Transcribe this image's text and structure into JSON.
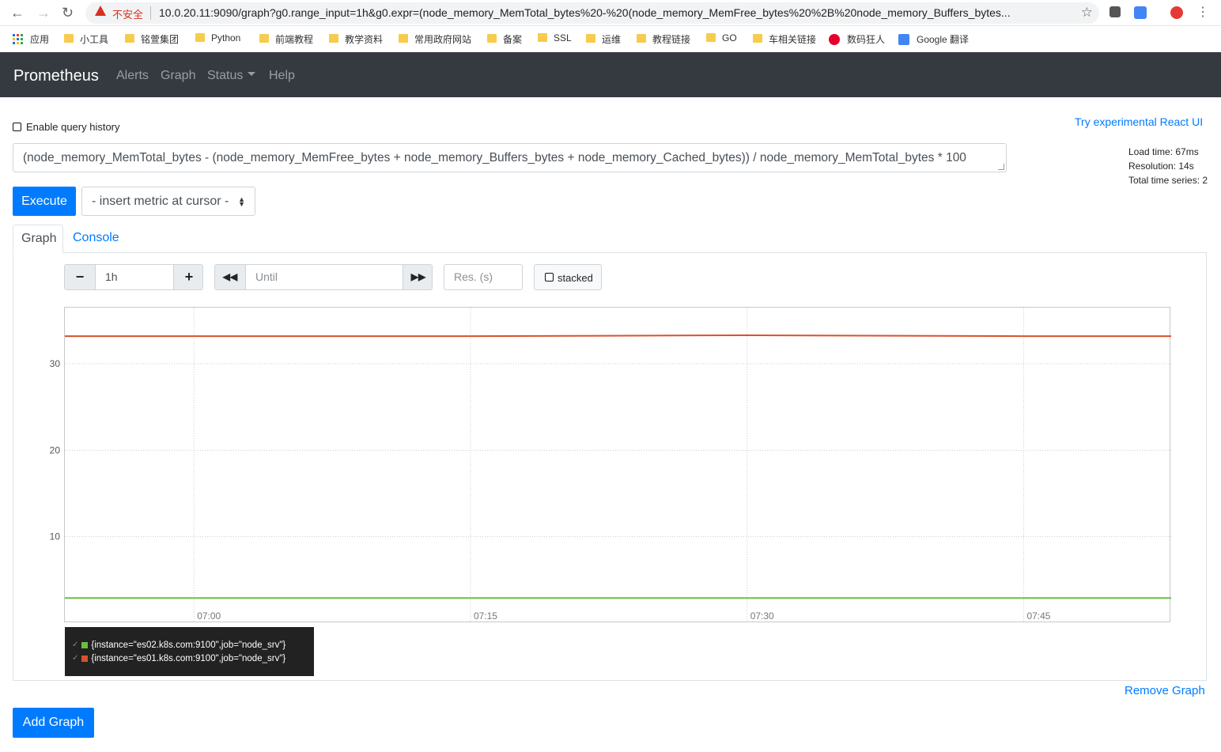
{
  "browser": {
    "not_secure": "不安全",
    "url": "10.0.20.11:9090/graph?g0.range_input=1h&g0.expr=(node_memory_MemTotal_bytes%20-%20(node_memory_MemFree_bytes%20%2B%20node_memory_Buffers_bytes...",
    "bookmarks": [
      {
        "label": "应用",
        "icon": "apps-icon"
      },
      {
        "label": "小工具",
        "icon": "folder-icon"
      },
      {
        "label": "铭萱集团",
        "icon": "folder-icon"
      },
      {
        "label": "Python",
        "icon": "folder-icon"
      },
      {
        "label": "前端教程",
        "icon": "folder-icon"
      },
      {
        "label": "教学资料",
        "icon": "folder-icon"
      },
      {
        "label": "常用政府网站",
        "icon": "folder-icon"
      },
      {
        "label": "备案",
        "icon": "folder-icon"
      },
      {
        "label": "SSL",
        "icon": "folder-icon"
      },
      {
        "label": "运维",
        "icon": "folder-icon"
      },
      {
        "label": "教程链接",
        "icon": "folder-icon"
      },
      {
        "label": "GO",
        "icon": "folder-icon"
      },
      {
        "label": "车相关链接",
        "icon": "folder-icon"
      },
      {
        "label": "数码狂人",
        "icon": "site-icon"
      },
      {
        "label": "Google 翻译",
        "icon": "translate-icon"
      }
    ]
  },
  "navbar": {
    "brand": "Prometheus",
    "links": [
      "Alerts",
      "Graph",
      "Status",
      "Help"
    ]
  },
  "page": {
    "enable_history": "Enable query history",
    "react_ui_link": "Try experimental React UI",
    "expression": "(node_memory_MemTotal_bytes - (node_memory_MemFree_bytes + node_memory_Buffers_bytes + node_memory_Cached_bytes)) / node_memory_MemTotal_bytes * 100",
    "stats": {
      "load_time": "Load time: 67ms",
      "resolution": "Resolution: 14s",
      "total_series": "Total time series: 2"
    },
    "execute": "Execute",
    "insert_metric": "- insert metric at cursor -",
    "tabs": [
      "Graph",
      "Console"
    ],
    "range_value": "1h",
    "until_placeholder": "Until",
    "res_placeholder": "Res. (s)",
    "stacked": "stacked",
    "remove_graph": "Remove Graph",
    "add_graph": "Add Graph"
  },
  "colors": {
    "accent": "#007bff",
    "navbar": "#343a40",
    "series_green": "#6abf40",
    "series_red": "#d9512c"
  },
  "chart_data": {
    "type": "line",
    "x_ticks": [
      "07:00",
      "07:15",
      "07:30",
      "07:45"
    ],
    "x": [
      "06:53",
      "07:00",
      "07:15",
      "07:30",
      "07:45",
      "07:53"
    ],
    "y_ticks": [
      10,
      20,
      30
    ],
    "ylim": [
      0,
      36.5
    ],
    "grid": true,
    "legend_position": "bottom-left",
    "series": [
      {
        "name": "{instance=\"es02.k8s.com:9100\",job=\"node_srv\"}",
        "values": [
          2.9,
          2.9,
          2.9,
          2.9,
          2.9,
          2.9
        ]
      },
      {
        "name": "{instance=\"es01.k8s.com:9100\",job=\"node_srv\"}",
        "values": [
          33.2,
          33.2,
          33.2,
          33.3,
          33.2,
          33.2
        ]
      }
    ]
  }
}
